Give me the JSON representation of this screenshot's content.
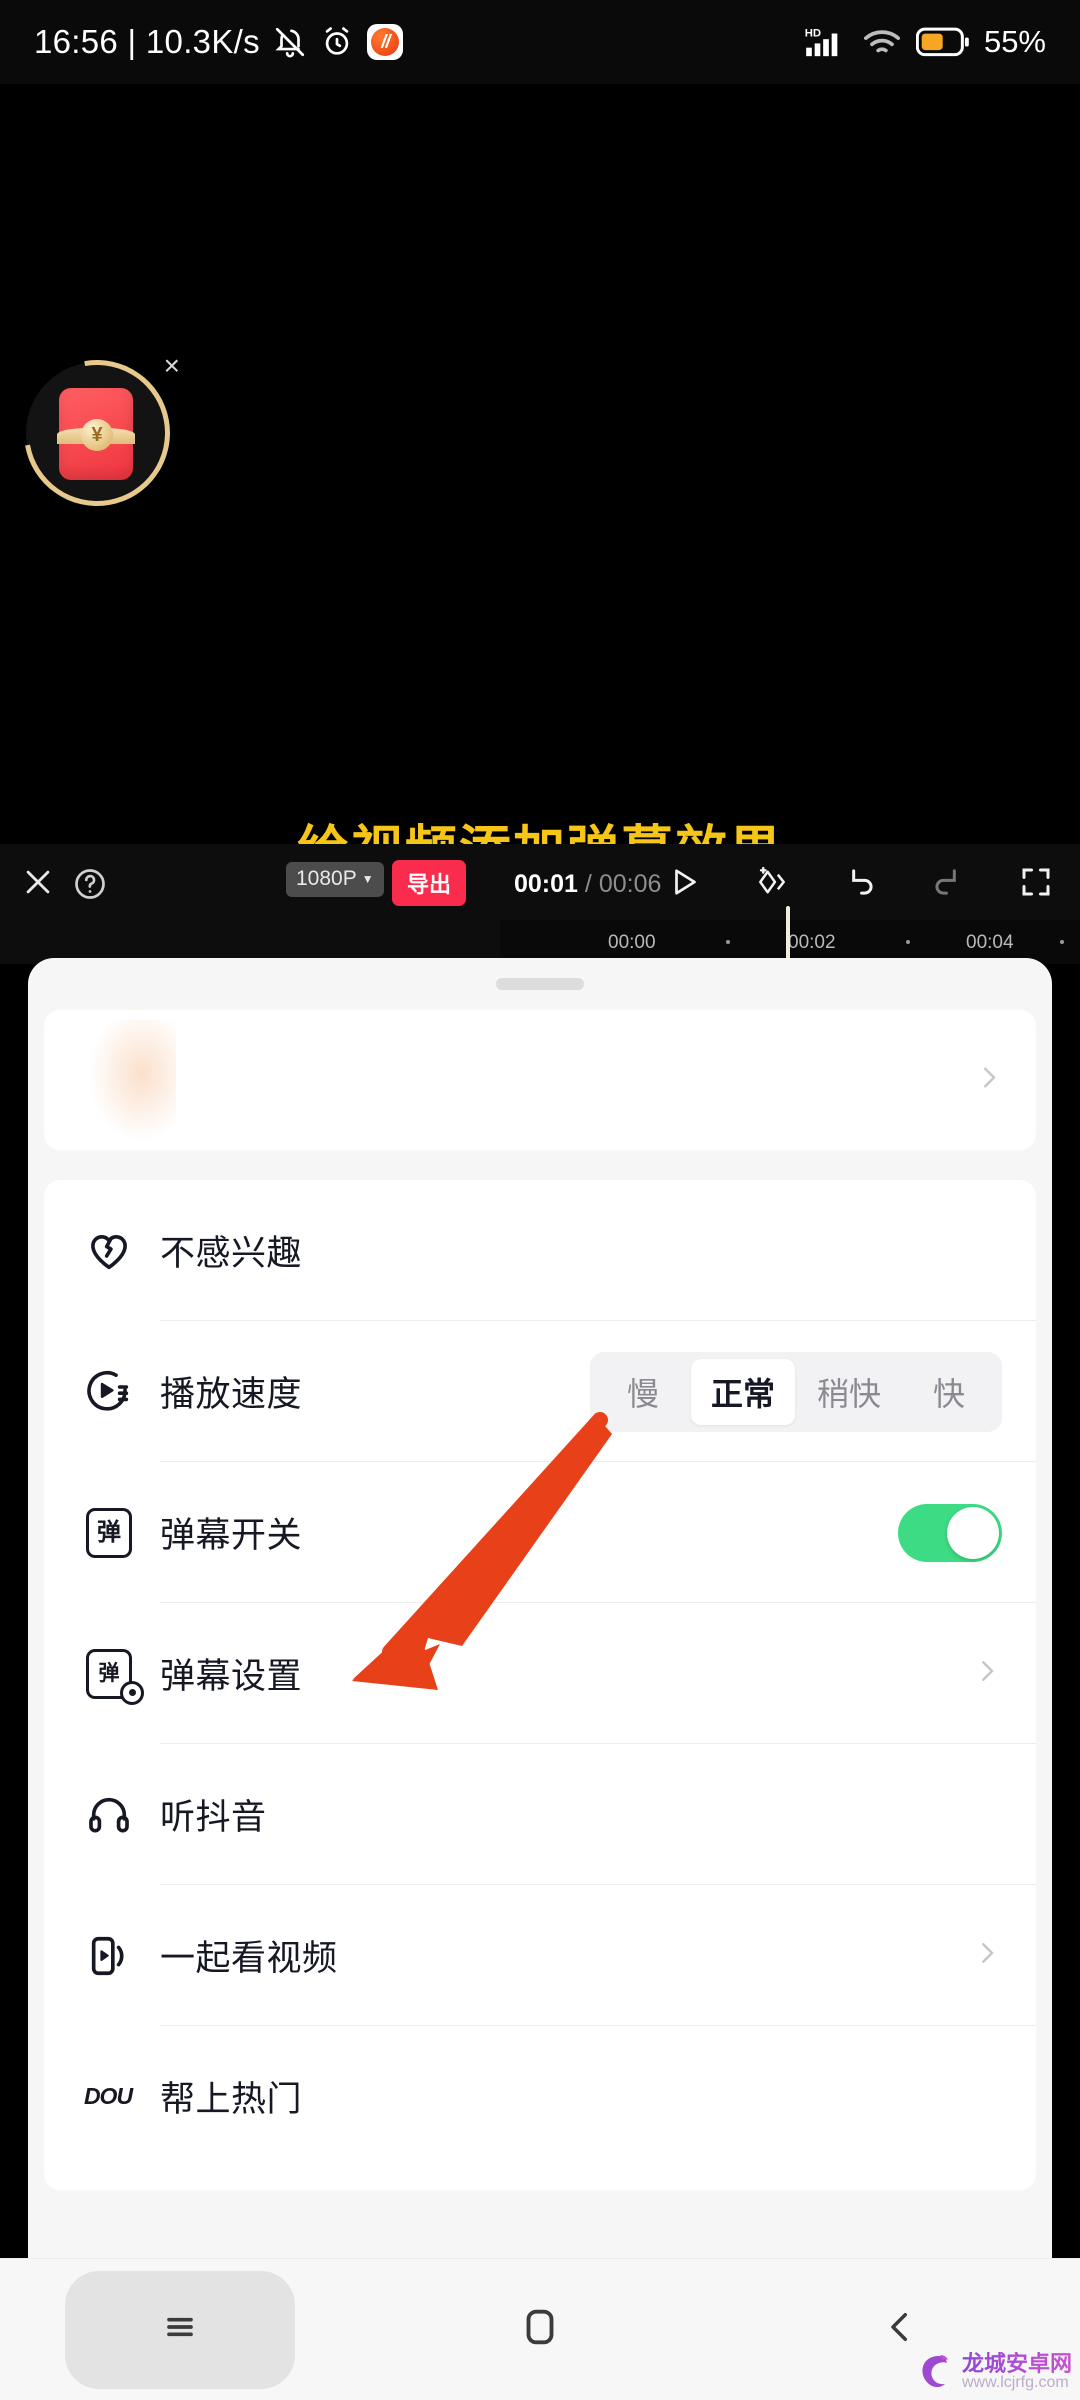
{
  "status_bar": {
    "clock": "16:56 | 10.3K/s",
    "mute_icon": "bell-muted-icon",
    "alarm_icon": "alarm-clock-icon",
    "app_icon": "douyin-app-icon",
    "network_label": "HD",
    "signal_icon": "signal-bars-icon",
    "wifi_icon": "wifi-icon",
    "battery_icon": "battery-icon",
    "battery_text": "55%",
    "battery_color": "#f5a623"
  },
  "overlay": {
    "headline": "给视频添加弹幕效果",
    "headline_color": "#f5c518",
    "float_widget": {
      "name": "red-envelope-reward",
      "coin_symbol": "¥",
      "close_label": "×",
      "ring_color": "#e7c98b",
      "envelope_color": "#f0353f"
    }
  },
  "editor": {
    "close_label": "✕",
    "help_label": "?",
    "resolution": "1080P",
    "resolution_caret": "▼",
    "export_label": "导出",
    "export_color": "#fa2c4e",
    "current_time": "00:01",
    "time_separator": "/",
    "total_time": "00:06",
    "actions": [
      "play-icon",
      "keyframe-icon",
      "undo-icon",
      "redo-icon",
      "fullscreen-icon"
    ],
    "ruler_ticks": [
      "00:00",
      "00:02",
      "00:04"
    ]
  },
  "sheet": {
    "grabber": "drag-handle",
    "top_card": {
      "name": "promo-card",
      "chevron": "›"
    },
    "rows": [
      {
        "id": "not-interested",
        "icon": "broken-heart-icon",
        "label": "不感兴趣",
        "control": "none"
      },
      {
        "id": "playback-speed",
        "icon": "speed-icon",
        "label": "播放速度",
        "control": "segmented",
        "options": [
          "慢",
          "正常",
          "稍快",
          "快"
        ],
        "selected": "正常"
      },
      {
        "id": "danmaku-switch",
        "icon": "danmaku-box-icon",
        "icon_glyph": "弹",
        "label": "弹幕开关",
        "control": "toggle",
        "toggle_on": true,
        "toggle_color": "#3ddc84"
      },
      {
        "id": "danmaku-settings",
        "icon": "danmaku-settings-icon",
        "icon_glyph": "弹",
        "label": "弹幕设置",
        "control": "chevron",
        "chevron": "›"
      },
      {
        "id": "listen-douyin",
        "icon": "headphones-icon",
        "label": "听抖音",
        "control": "none"
      },
      {
        "id": "watch-together",
        "icon": "watch-together-icon",
        "label": "一起看视频",
        "control": "chevron",
        "chevron": "›"
      },
      {
        "id": "promote",
        "icon": "dou-plus-icon",
        "icon_glyph": "DOU",
        "label": "帮上热门",
        "control": "none"
      }
    ]
  },
  "annotation": {
    "arrow_color": "#e8411a",
    "points_to": "弹幕设置"
  },
  "navbar": {
    "recents": "recents-icon",
    "home": "home-icon",
    "back": "back-icon"
  },
  "watermark": {
    "title": "龙城安卓网",
    "url": "www.lcjrfg.com"
  }
}
